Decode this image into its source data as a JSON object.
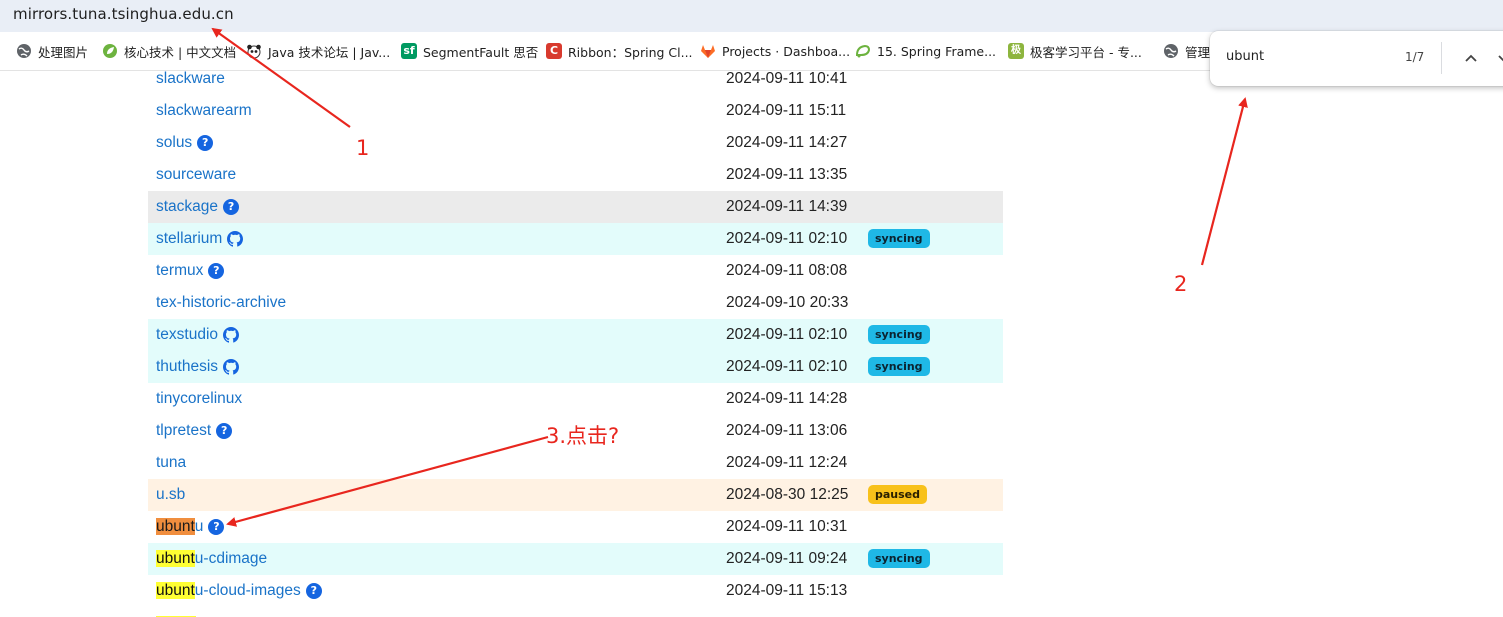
{
  "browser": {
    "url": "mirrors.tuna.tsinghua.edu.cn",
    "bookmarks": [
      {
        "label": "处理图片",
        "icon": "globe-icon"
      },
      {
        "label": "核心技术 | 中文文档",
        "icon": "spring-leaf-icon"
      },
      {
        "label": "Java 技术论坛 | Jav...",
        "icon": "panda-icon"
      },
      {
        "label": "SegmentFault 思否",
        "icon": "segmentfault-icon"
      },
      {
        "label": "Ribbon：Spring Cl...",
        "icon": "c-logo-icon"
      },
      {
        "label": "Projects · Dashboa...",
        "icon": "gitlab-icon"
      },
      {
        "label": "15. Spring Frame...",
        "icon": "spring-icon"
      },
      {
        "label": "极客学习平台 - 专...",
        "icon": "geek-icon"
      },
      {
        "label": "管理",
        "icon": "globe-icon"
      }
    ],
    "find": {
      "query": "ubunt",
      "count": "1/7"
    }
  },
  "status_colors": {
    "syncing": "#1fb8e6",
    "paused": "#f8c11a",
    "link": "#1a73c8"
  },
  "rows": [
    {
      "name": "slackware",
      "date": "2024-09-11 10:41"
    },
    {
      "name": "slackwarearm",
      "date": "2024-09-11 15:11"
    },
    {
      "name": "solus",
      "date": "2024-09-11 14:27",
      "help": "?"
    },
    {
      "name": "sourceware",
      "date": "2024-09-11 13:35"
    },
    {
      "name": "stackage",
      "date": "2024-09-11 14:39",
      "help": "?"
    },
    {
      "name": "stellarium",
      "date": "2024-09-11 02:10",
      "status": "syncing"
    },
    {
      "name": "termux",
      "date": "2024-09-11 08:08",
      "help": "?"
    },
    {
      "name": "tex-historic-archive",
      "date": "2024-09-10 20:33"
    },
    {
      "name": "texstudio",
      "date": "2024-09-11 02:10",
      "status": "syncing"
    },
    {
      "name": "thuthesis",
      "date": "2024-09-11 02:10",
      "status": "syncing"
    },
    {
      "name": "tinycorelinux",
      "date": "2024-09-11 14:28"
    },
    {
      "name": "tlpretest",
      "date": "2024-09-11 13:06",
      "help": "?"
    },
    {
      "name": "tuna",
      "date": "2024-09-11 12:24"
    },
    {
      "name": "u.sb",
      "date": "2024-08-30 12:25",
      "status": "paused"
    },
    {
      "name_hl": "ubunt",
      "name_rest": "u",
      "date": "2024-09-11 10:31",
      "help": "?"
    },
    {
      "name_hl": "ubunt",
      "name_rest": "u-cdimage",
      "date": "2024-09-11 09:24",
      "status": "syncing"
    },
    {
      "name_hl": "ubunt",
      "name_rest": "u-cloud-images",
      "date": "2024-09-11 15:13",
      "help": "?"
    }
  ],
  "annotations": {
    "label1": "1",
    "label2": "2",
    "label3": "3.点击?"
  }
}
